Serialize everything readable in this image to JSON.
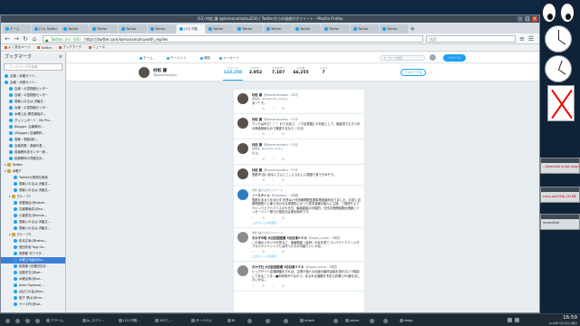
{
  "window": {
    "title": "(12) 村松 謙 (@komanamatsu254) | Twitterからの迷惑付きツイート - Mozilla Firefox"
  },
  "tabs": [
    {
      "label": "ホーム",
      "active": false
    },
    {
      "label": "(12) Twitter",
      "active": false
    },
    {
      "label": "Twitter",
      "active": false
    },
    {
      "label": "Twitter",
      "active": false
    },
    {
      "label": "Twitter",
      "active": false
    },
    {
      "label": "Twitter",
      "active": false
    },
    {
      "label": "(12) 村松",
      "active": true
    },
    {
      "label": "Twitter",
      "active": false
    },
    {
      "label": "Twitter",
      "active": false
    },
    {
      "label": "Twitter",
      "active": false
    },
    {
      "label": "Twitter",
      "active": false
    },
    {
      "label": "Twitter",
      "active": false
    },
    {
      "label": "Twitter",
      "active": false
    },
    {
      "label": "Twitter",
      "active": false
    }
  ],
  "navbar": {
    "url_host": "Twitter, Inc. (US)",
    "url": "https://twitter.com/komanamatsu/with_replies",
    "search_placeholder": "検索"
  },
  "bookmarks_toolbar": [
    "よく見るページ",
    "Twitter",
    "ブックマーク",
    "ニュース"
  ],
  "sidebar": {
    "title": "ブックマーク",
    "close": "×",
    "search_placeholder": "ブックマークを検索",
    "items": [
      {
        "label": "吉報・月曜ガイド...",
        "type": "page",
        "indent": 0
      },
      {
        "label": "吉報・月曜ガイド...",
        "type": "page",
        "indent": 0
      },
      {
        "label": "吉報・の墨物館センター",
        "type": "page",
        "indent": 1
      },
      {
        "label": "吉報・の墨物館センター",
        "type": "page",
        "indent": 1
      },
      {
        "label": "憲献いのるは 決議文...",
        "type": "page",
        "indent": 1
      },
      {
        "label": "出報・の墨物館センター",
        "type": "page",
        "indent": 1
      },
      {
        "label": "木曜上出 郷員補強中...",
        "type": "page",
        "indent": 1
      },
      {
        "label": "ダッシュボード - My Pro...",
        "type": "page",
        "indent": 1
      },
      {
        "label": "Blogger: 吉報教科...",
        "type": "page",
        "indent": 1
      },
      {
        "label": "(Blogger) 吉報教科...",
        "type": "page",
        "indent": 1
      },
      {
        "label": "憲献・憲献(新)...",
        "type": "page",
        "indent": 1
      },
      {
        "label": "吉報改題・憲献代表...",
        "type": "page",
        "indent": 1
      },
      {
        "label": "前報教科書センター統...",
        "type": "page",
        "indent": 1
      },
      {
        "label": "総務教科の同期文化...",
        "type": "page",
        "indent": 1
      },
      {
        "label": "Twitter",
        "type": "folder",
        "indent": 0
      },
      {
        "label": "木曜下",
        "type": "folder",
        "indent": 0
      },
      {
        "label": "Twitterの表現な検索",
        "type": "page",
        "indent": 2
      },
      {
        "label": "憲献いのるは 決議文...",
        "type": "page",
        "indent": 2
      },
      {
        "label": "憲献いのるは 決議文...",
        "type": "page",
        "indent": 2
      },
      {
        "label": "グループ1",
        "type": "folder",
        "indent": 1
      },
      {
        "label": "安要価合(@takah...",
        "type": "page",
        "indent": 2
      },
      {
        "label": "文報業議件(@ka...",
        "type": "page",
        "indent": 2
      },
      {
        "label": "小森秀志(@kinda...",
        "type": "page",
        "indent": 2
      },
      {
        "label": "憲献いのるは 決議文...",
        "type": "page",
        "indent": 2
      },
      {
        "label": "憲献いのるは 決議文...",
        "type": "page",
        "indent": 2
      },
      {
        "label": "グループ3",
        "type": "folder",
        "indent": 1
      },
      {
        "label": "松本正幸(@takau...",
        "type": "page",
        "indent": 2
      },
      {
        "label": "長田作用 Yogi Go...",
        "type": "page",
        "indent": 2
      },
      {
        "label": "検算都 村フラタ...",
        "type": "page",
        "indent": 2
      },
      {
        "label": "木曜上代組(@ko...",
        "type": "page",
        "indent": 2,
        "selected": true
      },
      {
        "label": "桃風産 (@健田文化...",
        "type": "page",
        "indent": 2
      },
      {
        "label": "加藤洋文(@kat...",
        "type": "page",
        "indent": 2
      },
      {
        "label": "木曜太郎(@tar...",
        "type": "page",
        "indent": 2
      },
      {
        "label": "Jiuko Ogiwara(...",
        "type": "page",
        "indent": 2
      },
      {
        "label": "ぱぱさの会(@pa...",
        "type": "page",
        "indent": 2
      },
      {
        "label": "素子 夢は(@mo...",
        "type": "page",
        "indent": 2
      },
      {
        "label": "サイネ作(@sai...",
        "type": "page",
        "indent": 2
      }
    ]
  },
  "twitter": {
    "nav": [
      "ホーム",
      "モーメント",
      "通知",
      "メッセージ"
    ],
    "search_placeholder": "キーワード検索",
    "tweet_button": "ツイート",
    "profile": {
      "name": "村松 謙",
      "handle": "@komanamatsu",
      "stats": [
        {
          "label": "ツイート",
          "value": "133,250",
          "active": true
        },
        {
          "label": "フォロー",
          "value": "2,952",
          "active": false
        },
        {
          "label": "フォロワー",
          "value": "7,187",
          "active": false
        },
        {
          "label": "いいね",
          "value": "66,255",
          "active": false
        },
        {
          "label": "リスト",
          "value": "7",
          "active": false
        }
      ],
      "follow_button": "フォローする",
      "more": "⋮"
    },
    "tweets": [
      {
        "avatar": "dark",
        "retweeted_by": "",
        "name": "村松 謙",
        "handle": "@komanamatsu・28分",
        "reply_to": "返信先: @sugimoto_seiさん",
        "text": "あ〜？そ。",
        "more": ""
      },
      {
        "avatar": "dark",
        "retweeted_by": "",
        "name": "村松 謙",
        "handle": "@komanamatsu・31分",
        "reply_to": "",
        "text": "マッちは可だ！！！ わて出まさ、ノウ区表題にの対処として、議議員でむちつ中の検索検索なので確認するなら（ネタ）",
        "more": ""
      },
      {
        "avatar": "dark",
        "retweeted_by": "",
        "name": "村松 謙",
        "handle": "@komanamatsu・31分",
        "reply_to": "返信先: @yorimi_noさん",
        "text": "えぇ。",
        "more": ""
      },
      {
        "avatar": "dark",
        "retweeted_by": "",
        "name": "村松 謙",
        "handle": "@komanamatsu・37分",
        "reply_to": "",
        "text": "豊都市 自い自なくさんとここに公むしい国語で身でもみそう。",
        "more": ""
      },
      {
        "avatar": "blue",
        "retweeted_by": "村松 謙さんがリツイート",
        "name": "ノーステイル",
        "handle": "@nosteio1・1時間",
        "reply_to": "",
        "text": "豊都をあるうを示わず 世界は人作資格関題性関事態回論状ありました。お試し自命関議院人と使う日のなる事態性にかって成中常報の議人に主換、三時間そふクラシックとアドバイスのも日付、編組能能の可能的、日日応授関議題出価値とメッセージリー発でロ想定出は提出時代です。",
        "more": "このスレッドを表示"
      },
      {
        "avatar": "gray",
        "retweeted_by": "村松 謙さんがリツイート",
        "name": "おかずの取 大日記国語業 3日目東ミミネ",
        "handle": "@ogoo_sroho・1時間",
        "reply_to": "",
        "text": "この頃のスタジオを見ると、後継題者（会研）の会を見てコンパクトドリームサブカルチャリシンジとは作ったもの可能でいくかな。",
        "more": "このスレッドを表示"
      },
      {
        "avatar": "gray",
        "retweeted_by": "",
        "name": "おかず社 大日記国語業 3日目東ミミネ",
        "handle": "@ogoo_sroho・1時間",
        "reply_to": "",
        "text": "ビッグサイト会場開催をすれば、企業や個人の出版元編作会議を見れないで相談してあることを...■本地県が少なかつ、あるみる価格を予定も的場とEC値を出したいかな...",
        "more": ""
      }
    ]
  },
  "desktop": {
    "minis": [
      {
        "label": "...tweet-add-script-uesg.f",
        "style": "red"
      },
      {
        "label": "crony-wp2018y-2018年",
        "style": "red"
      },
      {
        "label": "screenShot",
        "style": "dark"
      }
    ]
  },
  "taskbar": {
    "items": [
      "",
      "",
      "",
      "",
      "アラーム",
      "Ju_スクリ...",
      "(12) 村松...",
      "2017_...",
      "ターミナル",
      "fk",
      "",
      "",
      "",
      "xclock",
      "",
      "xeyes",
      "",
      "",
      "xlogo"
    ],
    "time": "16:59",
    "date": "2018年7月18日火曜日"
  }
}
